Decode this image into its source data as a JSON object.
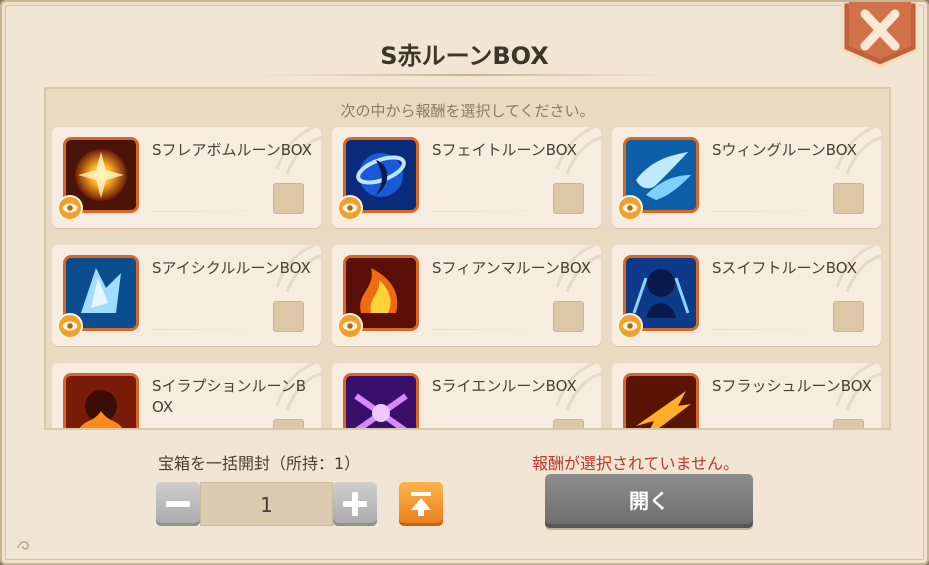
{
  "dialog": {
    "title": "S赤ルーンBOX",
    "close_icon": "close-x-icon"
  },
  "panel": {
    "instruction": "次の中から報酬を選択してください。"
  },
  "rewards": [
    {
      "name": "SフレアボムルーンBOX",
      "icon": "flare-bomb-rune-icon",
      "checked": false
    },
    {
      "name": "SフェイトルーンBOX",
      "icon": "fate-rune-icon",
      "checked": false
    },
    {
      "name": "SウィングルーンBOX",
      "icon": "wing-rune-icon",
      "checked": false
    },
    {
      "name": "SアイシクルルーンBOX",
      "icon": "icicle-rune-icon",
      "checked": false
    },
    {
      "name": "SフィアンマルーンBOX",
      "icon": "fiamma-rune-icon",
      "checked": false
    },
    {
      "name": "SスイフトルーンBOX",
      "icon": "swift-rune-icon",
      "checked": false
    },
    {
      "name": "SイラプションルーンBOX",
      "icon": "eruption-rune-icon",
      "checked": false
    },
    {
      "name": "SライエンルーンBOX",
      "icon": "raien-rune-icon",
      "checked": false
    },
    {
      "name": "SフラッシュルーンBOX",
      "icon": "flash-rune-icon",
      "checked": false
    }
  ],
  "bulk": {
    "label": "宝箱を一括開封（所持：1）",
    "quantity": "1"
  },
  "status": {
    "warning": "報酬が選択されていません。"
  },
  "actions": {
    "open_label": "開く"
  },
  "colors": {
    "warning": "#c0362c",
    "max_button": "#f0922e",
    "open_button_disabled": "#7d7d7d"
  }
}
